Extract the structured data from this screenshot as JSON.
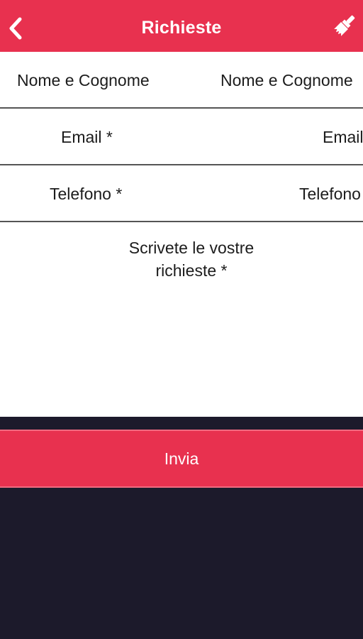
{
  "header": {
    "title": "Richieste",
    "back_icon": "chevron-left-icon",
    "right_icon": "brush-icon",
    "color": "#e8314f"
  },
  "form": {
    "name": {
      "label": "Nome e Cognome",
      "placeholder": "Nome e Cognome"
    },
    "email": {
      "label": "Email *",
      "placeholder": "Email"
    },
    "phone": {
      "label": "Telefono *",
      "placeholder": "Telefono"
    },
    "message": {
      "label_line1": "Scrivete le vostre",
      "label_line2": "richieste *"
    }
  },
  "submit": {
    "label": "Invia",
    "color": "#e8314f"
  },
  "background_color": "#1c1a2b"
}
